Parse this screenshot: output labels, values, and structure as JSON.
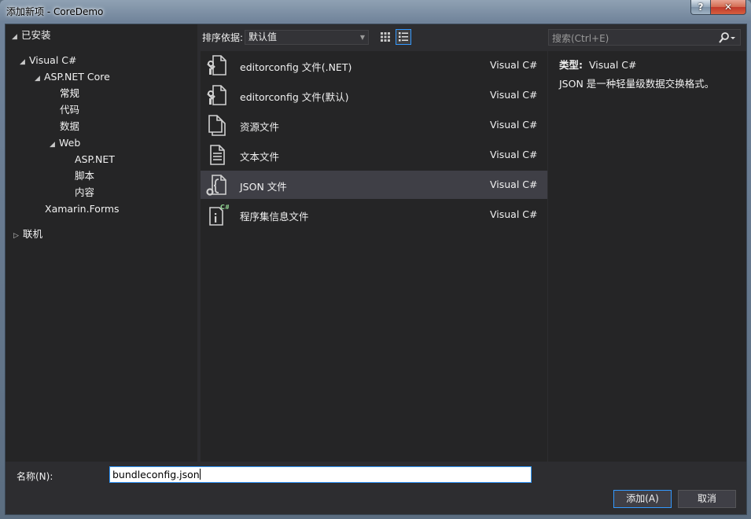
{
  "window": {
    "title": "添加新项 - CoreDemo",
    "help_label": "?",
    "close_label": "✕"
  },
  "tree": {
    "installed": "已安装",
    "visual_csharp": "Visual C#",
    "aspnet_core": "ASP.NET Core",
    "general": "常规",
    "code": "代码",
    "data": "数据",
    "web": "Web",
    "aspnet": "ASP.NET",
    "script": "脚本",
    "content": "内容",
    "xamarin_forms": "Xamarin.Forms",
    "online": "联机"
  },
  "toolbar": {
    "sort_label": "排序依据:",
    "sort_value": "默认值"
  },
  "items": [
    {
      "name": "editorconfig 文件(.NET)",
      "lang": "Visual C#",
      "icon": "editorconfig-icon"
    },
    {
      "name": "editorconfig 文件(默认)",
      "lang": "Visual C#",
      "icon": "editorconfig-icon"
    },
    {
      "name": "资源文件",
      "lang": "Visual C#",
      "icon": "resource-file-icon"
    },
    {
      "name": "文本文件",
      "lang": "Visual C#",
      "icon": "text-file-icon"
    },
    {
      "name": "JSON 文件",
      "lang": "Visual C#",
      "icon": "json-file-icon"
    },
    {
      "name": "程序集信息文件",
      "lang": "Visual C#",
      "icon": "assembly-info-icon"
    }
  ],
  "search": {
    "placeholder": "搜索(Ctrl+E)"
  },
  "details": {
    "type_label": "类型:",
    "type_value": "Visual C#",
    "description": "JSON 是一种轻量级数据交换格式。"
  },
  "bottom": {
    "name_label": "名称(N):",
    "name_value": "bundleconfig.json",
    "add_label": "添加(A)",
    "cancel_label": "取消"
  },
  "colors": {
    "background": "#2d2d30",
    "panel": "#252526",
    "selection": "#3f3f46",
    "accent": "#3399ff",
    "text": "#f1f1f1"
  }
}
